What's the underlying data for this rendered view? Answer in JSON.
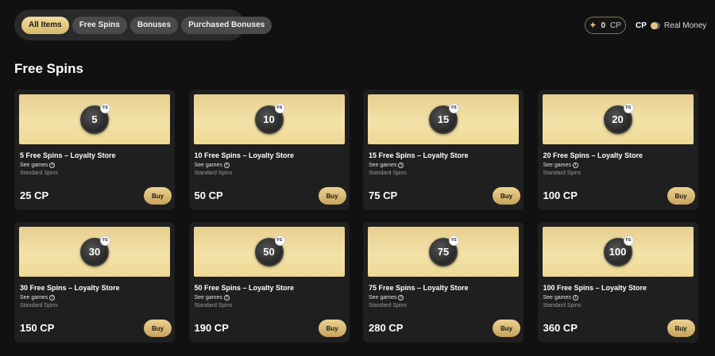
{
  "filters": {
    "tabs": [
      {
        "label": "All Items",
        "active": true
      },
      {
        "label": "Free Spins",
        "active": false
      },
      {
        "label": "Bonuses",
        "active": false
      },
      {
        "label": "Purchased Bonuses",
        "active": false
      }
    ]
  },
  "balance": {
    "amount": "0",
    "unit": "CP",
    "icon": "sparkle-icon"
  },
  "currency_toggle": {
    "left_label": "CP",
    "right_label": "Real Money",
    "selected": "CP"
  },
  "section": {
    "title": "Free Spins"
  },
  "products": [
    {
      "badge_value": "5",
      "badge_tag": "FS",
      "title": "5 Free Spins – Loyalty Store",
      "see_games": "See games",
      "tier": "Standard Spins",
      "price": "25 CP",
      "buy_label": "Buy"
    },
    {
      "badge_value": "10",
      "badge_tag": "FS",
      "title": "10 Free Spins – Loyalty Store",
      "see_games": "See games",
      "tier": "Standard Spins",
      "price": "50 CP",
      "buy_label": "Buy"
    },
    {
      "badge_value": "15",
      "badge_tag": "FS",
      "title": "15 Free Spins – Loyalty Store",
      "see_games": "See games",
      "tier": "Standard Spins",
      "price": "75 CP",
      "buy_label": "Buy"
    },
    {
      "badge_value": "20",
      "badge_tag": "FS",
      "title": "20 Free Spins – Loyalty Store",
      "see_games": "See games",
      "tier": "Standard Spins",
      "price": "100 CP",
      "buy_label": "Buy"
    },
    {
      "badge_value": "30",
      "badge_tag": "FS",
      "title": "30 Free Spins – Loyalty Store",
      "see_games": "See games",
      "tier": "Standard Spins",
      "price": "150 CP",
      "buy_label": "Buy"
    },
    {
      "badge_value": "50",
      "badge_tag": "FS",
      "title": "50 Free Spins – Loyalty Store",
      "see_games": "See games",
      "tier": "Standard Spins",
      "price": "190 CP",
      "buy_label": "Buy"
    },
    {
      "badge_value": "75",
      "badge_tag": "FS",
      "title": "75 Free Spins – Loyalty Store",
      "see_games": "See games",
      "tier": "Standard Spins",
      "price": "280 CP",
      "buy_label": "Buy"
    },
    {
      "badge_value": "100",
      "badge_tag": "FS",
      "title": "100 Free Spins – Loyalty Store",
      "see_games": "See games",
      "tier": "Standard Spins",
      "price": "360 CP",
      "buy_label": "Buy"
    }
  ],
  "colors": {
    "accent_gold": "#e3c47f",
    "background": "#111111",
    "card": "#1f1f1f"
  }
}
